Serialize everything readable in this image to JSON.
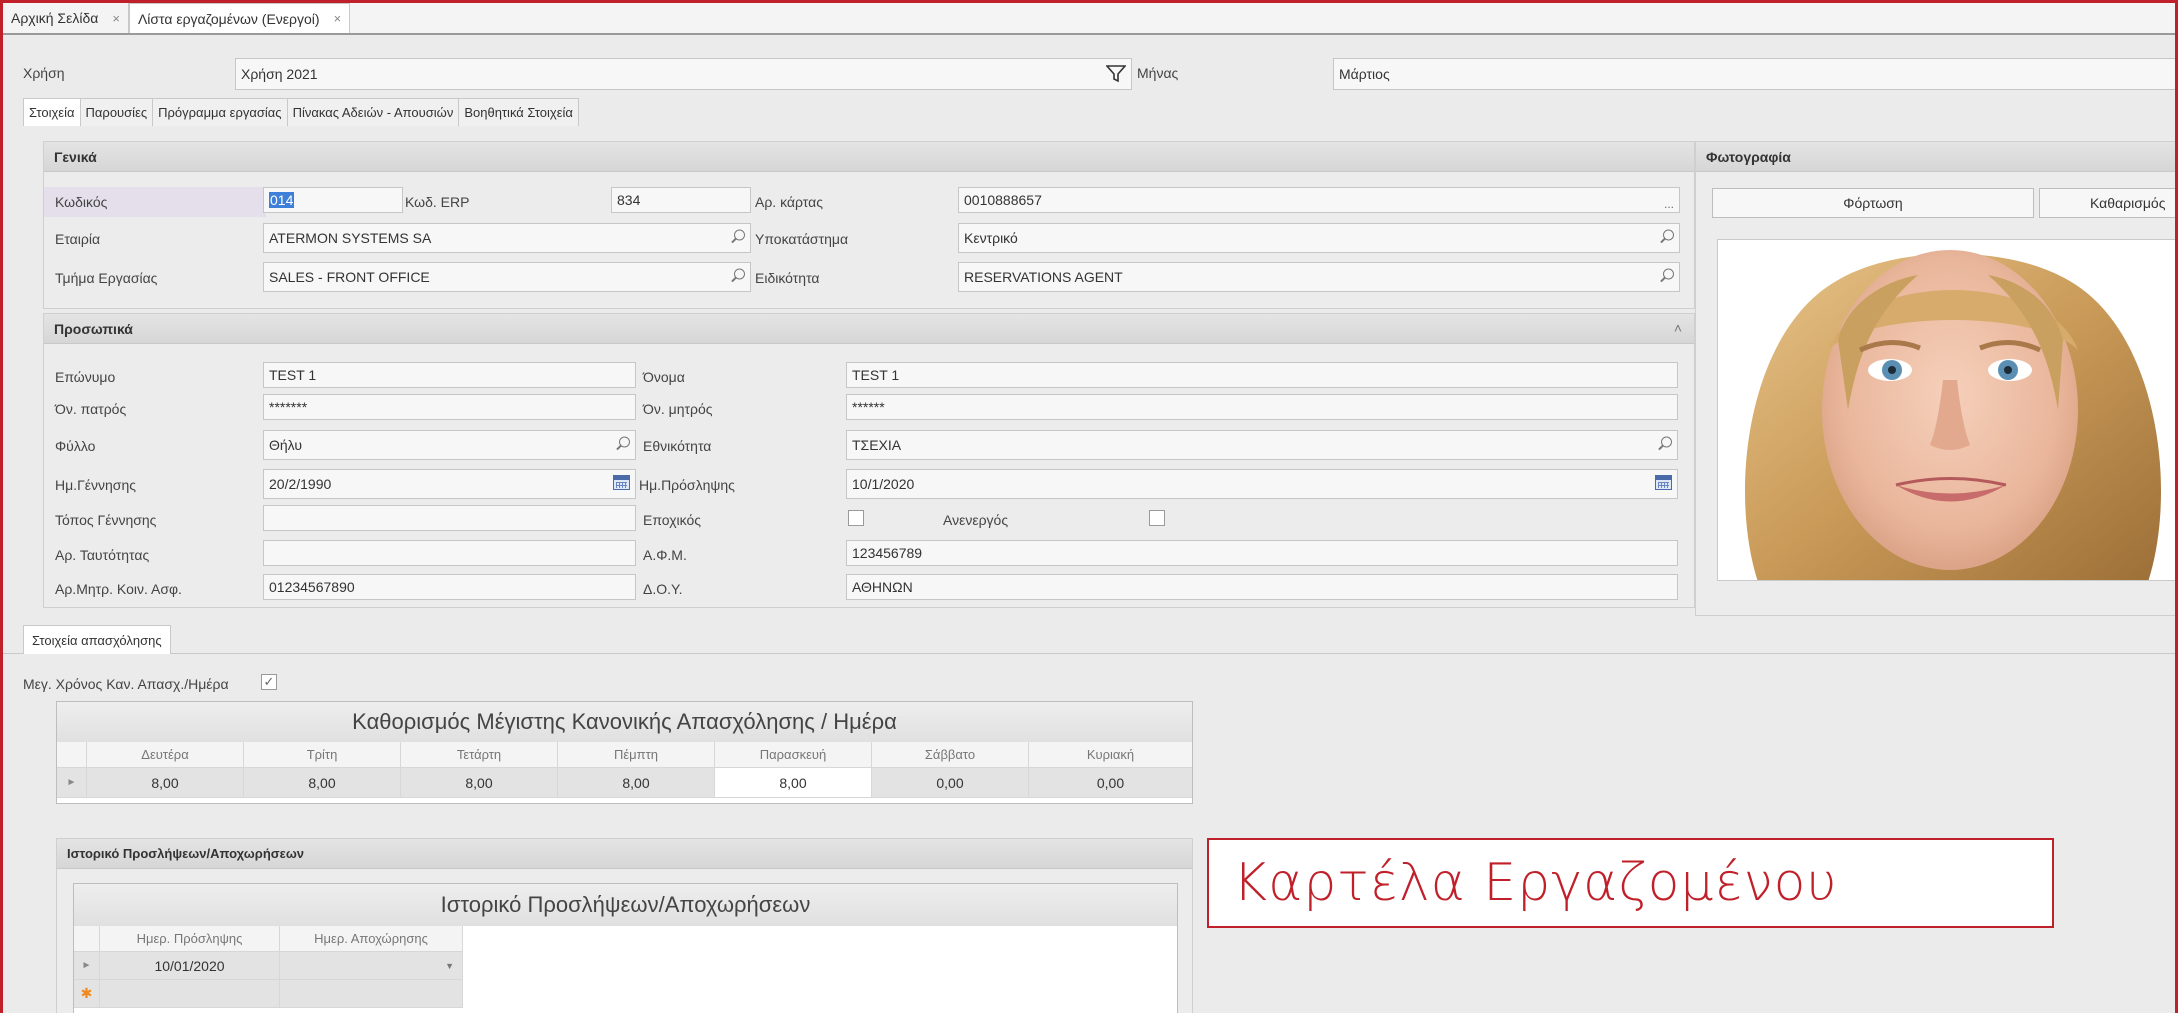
{
  "doc_tabs": [
    {
      "label": "Αρχική Σελίδα"
    },
    {
      "label": "Λίστα εργαζομένων (Ενεργοί)"
    }
  ],
  "filters": {
    "year_label": "Χρήση",
    "year_value": "Χρήση 2021",
    "month_label": "Μήνας",
    "month_value": "Μάρτιος"
  },
  "tabs": [
    "Στοιχεία",
    "Παρουσίες",
    "Πρόγραμμα εργασίας",
    "Πίνακας Αδειών - Απουσιών",
    "Βοηθητικά Στοιχεία"
  ],
  "general": {
    "title": "Γενικά",
    "code_label": "Κωδικός",
    "code_value": "014",
    "erp_label": "Κωδ. ERP",
    "erp_value": "834",
    "card_label": "Αρ. κάρτας",
    "card_value": "0010888657",
    "card_more": "...",
    "company_label": "Εταιρία",
    "company_value": "ATERMON SYSTEMS  SA",
    "branch_label": "Υποκατάστημα",
    "branch_value": "Κεντρικό",
    "dept_label": "Τμήμα Εργασίας",
    "dept_value": "SALES - FRONT OFFICE",
    "specialty_label": "Ειδικότητα",
    "specialty_value": "RESERVATIONS AGENT"
  },
  "photo": {
    "title": "Φωτογραφία",
    "load_label": "Φόρτωση",
    "clear_label": "Καθαρισμός"
  },
  "personal": {
    "title": "Προσωπικά",
    "surname_label": "Επώνυμο",
    "surname_value": "TEST 1",
    "name_label": "Όνομα",
    "name_value": "TEST 1",
    "father_label": "Όν. πατρός",
    "father_value": "*******",
    "mother_label": "Όν. μητρός",
    "mother_value": "******",
    "gender_label": "Φύλλο",
    "gender_value": "Θήλυ",
    "nationality_label": "Εθνικότητα",
    "nationality_value": "ΤΣΕΧΙΑ",
    "birth_label": "Ημ.Γέννησης",
    "birth_value": "20/2/1990",
    "hire_label": "Ημ.Πρόσληψης",
    "hire_value": "10/1/2020",
    "birthplace_label": "Τόπος Γέννησης",
    "birthplace_value": "",
    "seasonal_label": "Εποχικός",
    "inactive_label": "Ανενεργός",
    "id_label": "Αρ. Ταυτότητας",
    "id_value": "",
    "afm_label": "Α.Φ.Μ.",
    "afm_value": "123456789",
    "amka_label": "Αρ.Μητρ. Κοιν. Ασφ.",
    "amka_value": "01234567890",
    "doy_label": "Δ.Ο.Υ.",
    "doy_value": "ΑΘΗΝΩΝ"
  },
  "employment": {
    "tab_label": "Στοιχεία απασχόλησης",
    "max_time_label": "Μεγ. Χρόνος Καν. Απασχ./Ημέρα",
    "max_time_checked": true,
    "grid_title": "Καθορισμός Μέγιστης Κανονικής Απασχόλησης / Ημέρα",
    "columns": [
      "Δευτέρα",
      "Τρίτη",
      "Τετάρτη",
      "Πέμπτη",
      "Παρασκευή",
      "Σάββατο",
      "Κυριακή"
    ],
    "values": [
      "8,00",
      "8,00",
      "8,00",
      "8,00",
      "8,00",
      "0,00",
      "0,00"
    ]
  },
  "history": {
    "group_title": "Ιστορικό Προσλήψεων/Αποχωρήσεων",
    "grid_title": "Ιστορικό Προσλήψεων/Αποχωρήσεων",
    "columns": [
      "Ημερ. Πρόσληψης",
      "Ημερ. Αποχώρησης"
    ],
    "rows": [
      [
        "10/01/2020",
        ""
      ]
    ]
  },
  "callout": "Καρτέλα Εργαζομένου"
}
